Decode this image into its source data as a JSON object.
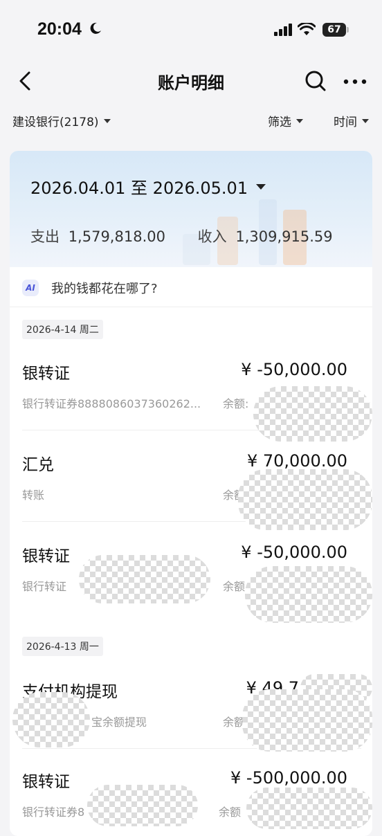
{
  "status_bar": {
    "time": "20:04",
    "battery": "67"
  },
  "nav": {
    "title": "账户明细"
  },
  "filters": {
    "account": "建设银行(2178)",
    "filter": "筛选",
    "sort": "时间"
  },
  "summary": {
    "date_range": "2026.04.01 至 2026.05.01",
    "expense_label": "支出",
    "expense_value": "1,579,818.00",
    "income_label": "收入",
    "income_value": "1,309,915.59"
  },
  "ai_prompt": {
    "badge": "AI",
    "text": "我的钱都花在哪了?"
  },
  "groups": [
    {
      "date": "2026-4-14 周二",
      "transactions": [
        {
          "title": "银转证",
          "amount": "¥ -50,000.00",
          "sub": "银行转证券8888086037360262...",
          "balance_label": "余额:"
        },
        {
          "title": "汇兑",
          "amount": "¥ 70,000.00",
          "sub": "转账",
          "balance_label": "余额"
        },
        {
          "title": "银转证",
          "amount": "¥ -50,000.00",
          "sub": "银行转证",
          "balance_label": "余额"
        }
      ]
    },
    {
      "date": "2026-4-13 周一",
      "transactions": [
        {
          "title": "支付机构提现",
          "amount": "¥ 49,7",
          "sub": "宝余额提现",
          "balance_label": "余额"
        },
        {
          "title": "银转证",
          "amount": "¥ -500,000.00",
          "sub": "银行转证券8",
          "balance_label": "余额"
        }
      ]
    }
  ],
  "colors": {
    "accent": "#4a55d8",
    "header_gradient_top": "#d7e8f7",
    "page_bg": "#f4f4f6"
  }
}
